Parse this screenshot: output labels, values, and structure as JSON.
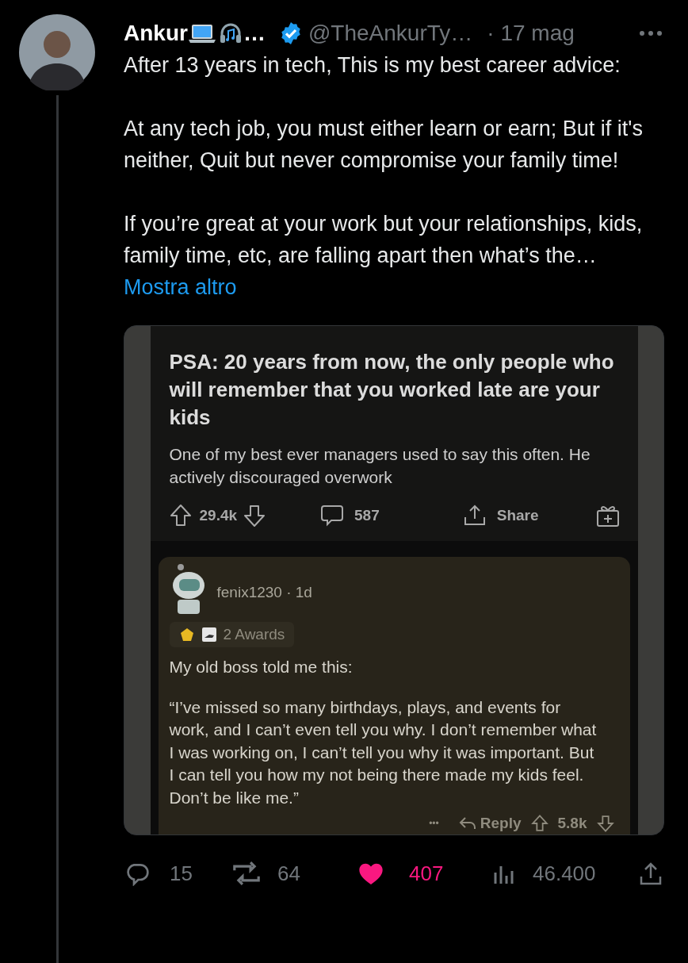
{
  "tweet": {
    "author": {
      "name": "Ankur",
      "name_more": "…",
      "verified": true,
      "handle": "@TheAnkurTy…",
      "time": "· 17 mag"
    },
    "paragraphs": [
      "After 13 years in tech, This is my best career advice:",
      "At any tech job, you must either learn or earn; But if it's neither, Quit but never compromise your family time!",
      "If you’re great at your work but your relationships, kids, family time, etc, are falling apart then what’s the…"
    ],
    "show_more": "Mostra altro",
    "embedded_post": {
      "title": "PSA: 20 years from now, the only people who will remember that you worked late are your kids",
      "body": "One of my best ever managers used to say this often. He actively discouraged overwork",
      "votes": "29.4k",
      "comments": "587",
      "share": "Share",
      "comment": {
        "user": "fenix1230 · 1d",
        "awards": "2 Awards",
        "paragraphs": [
          "My old boss told me this:",
          "“I’ve missed so many birthdays, plays, and events for work, and I can’t even tell you why.  I don’t remember what I was working on, I can’t tell you why it was important.  But I can tell you how my not being there made my kids feel.  Don’t be like me.”"
        ],
        "more": "•••",
        "reply": "Reply",
        "votes": "5.8k"
      }
    },
    "stats": {
      "replies": "15",
      "reposts": "64",
      "likes": "407",
      "liked": true,
      "views": "46.400"
    }
  }
}
